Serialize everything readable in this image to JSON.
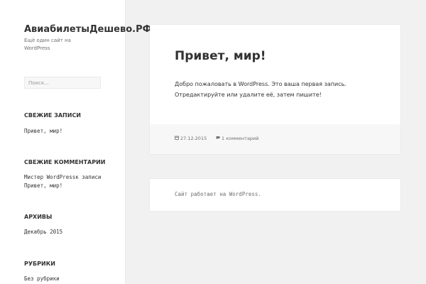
{
  "site": {
    "title": "АвиабилетыДешево.РФ",
    "description": "Ещё один сайт на WordPress"
  },
  "search": {
    "placeholder": "Поиск..."
  },
  "widgets": {
    "recent_posts": {
      "title": "СВЕЖИЕ ЗАПИСИ",
      "items": [
        "Привет, мир!"
      ]
    },
    "recent_comments": {
      "title": "СВЕЖИЕ КОММЕНТАРИИ",
      "author": "Мистер WordPress",
      "connector": "к записи",
      "post": "Привет, мир!"
    },
    "archives": {
      "title": "АРХИВЫ",
      "items": [
        "Декабрь 2015"
      ]
    },
    "categories": {
      "title": "РУБРИКИ",
      "items": [
        "Без рубрики"
      ]
    }
  },
  "post": {
    "title": "Привет, мир!",
    "content": "Добро пожаловать в WordPress. Это ваша первая запись. Отредактируйте или удалите её, затем пишите!",
    "date": "27.12.2015",
    "comments": "1 комментарий",
    "date_icon": "calendar-icon",
    "comments_icon": "comment-icon"
  },
  "footer": {
    "text": "Сайт работает на WordPress."
  }
}
